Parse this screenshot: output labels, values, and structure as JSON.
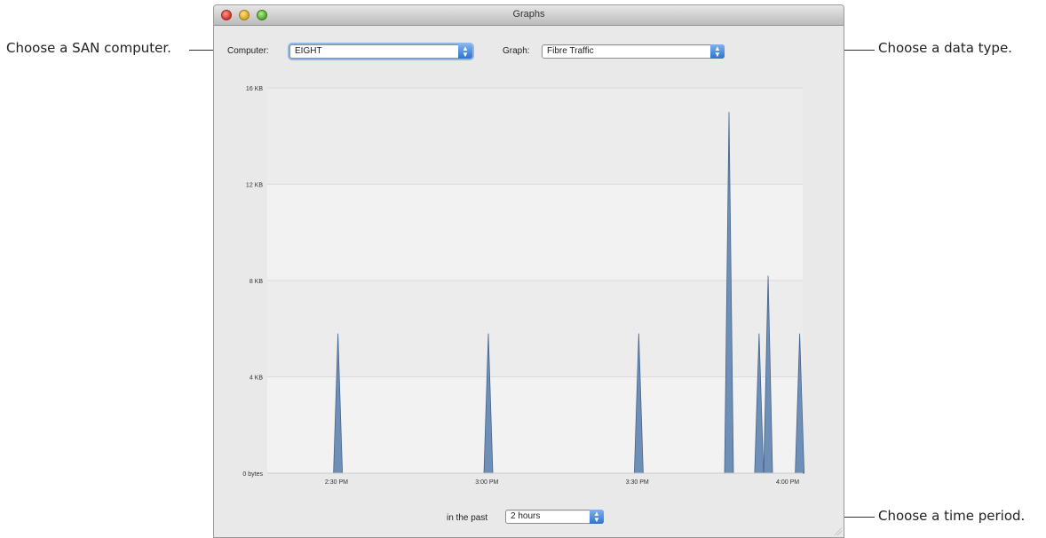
{
  "callouts": {
    "computer": "Choose a SAN computer.",
    "graph": "Choose a data type.",
    "period": "Choose a time period."
  },
  "window": {
    "title": "Graphs"
  },
  "controls": {
    "computer_label": "Computer:",
    "computer_value": "EIGHT",
    "graph_label": "Graph:",
    "graph_value": "Fibre Traffic",
    "past_label": "in the past",
    "past_value": "2 hours"
  },
  "chart_data": {
    "type": "area",
    "y_ticks": [
      "0 bytes",
      "4 KB",
      "8 KB",
      "12 KB",
      "16 KB"
    ],
    "x_ticks": [
      {
        "t": 0.5,
        "label": "2:30 PM"
      },
      {
        "t": 1.0,
        "label": "3:00 PM"
      },
      {
        "t": 1.5,
        "label": "3:30 PM"
      },
      {
        "t": 2.0,
        "label": "4:00 PM"
      }
    ],
    "ylim_kb": [
      0,
      16
    ],
    "xlim_hours": [
      0.27,
      2.05
    ],
    "spikes_kb": [
      {
        "t": 0.505,
        "value": 5.8
      },
      {
        "t": 1.005,
        "value": 5.8
      },
      {
        "t": 1.505,
        "value": 5.8
      },
      {
        "t": 1.805,
        "value": 15.0
      },
      {
        "t": 1.905,
        "value": 5.8
      },
      {
        "t": 1.935,
        "value": 8.2
      },
      {
        "t": 2.04,
        "value": 5.8
      }
    ],
    "grid": true,
    "colors": {
      "fill": "#6f8fb6",
      "stroke": "#44648c",
      "plot_bg": "#f2f2f2",
      "grid": "#dadada"
    }
  }
}
